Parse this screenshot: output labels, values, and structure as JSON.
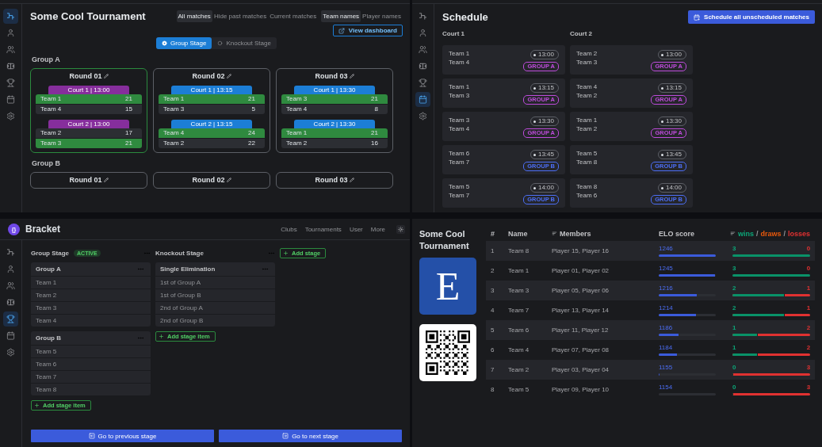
{
  "dashboard": {
    "sidebar": [
      {
        "kind": "bracket",
        "selected": true
      },
      {
        "kind": "user",
        "selected": false
      },
      {
        "kind": "users",
        "selected": false
      },
      {
        "kind": "court",
        "selected": false
      },
      {
        "kind": "trophy",
        "selected": false
      },
      {
        "kind": "calendar",
        "selected": false
      },
      {
        "kind": "settings",
        "selected": false
      }
    ],
    "title": "Some Cool Tournament",
    "filters": [
      {
        "label": "All matches",
        "selected": true
      },
      {
        "label": "Hide past matches",
        "selected": false
      },
      {
        "label": "Current matches",
        "selected": false
      }
    ],
    "name_modes": [
      {
        "label": "Team names",
        "selected": true
      },
      {
        "label": "Player names",
        "selected": false
      }
    ],
    "view_button": "View dashboard",
    "stage_tabs": [
      {
        "label": "Group Stage",
        "selected": true
      },
      {
        "label": "Knockout Stage",
        "selected": false
      }
    ],
    "groups": [
      {
        "name": "Group A",
        "rounds": [
          {
            "title": "Round 01",
            "active": true,
            "matches": [
              {
                "court": "Court 1 | 13:00",
                "color": "#862e9c",
                "teams": [
                  {
                    "name": "Team 1",
                    "score": "21",
                    "won": true
                  },
                  {
                    "name": "Team 4",
                    "score": "15",
                    "won": false
                  }
                ]
              },
              {
                "court": "Court 2 | 13:00",
                "color": "#862e9c",
                "teams": [
                  {
                    "name": "Team 2",
                    "score": "17",
                    "won": false
                  },
                  {
                    "name": "Team 3",
                    "score": "21",
                    "won": true
                  }
                ]
              }
            ]
          },
          {
            "title": "Round 02",
            "active": false,
            "matches": [
              {
                "court": "Court 1 | 13:15",
                "color": "#1c7ed6",
                "teams": [
                  {
                    "name": "Team 1",
                    "score": "21",
                    "won": true
                  },
                  {
                    "name": "Team 3",
                    "score": "5",
                    "won": false
                  }
                ]
              },
              {
                "court": "Court 2 | 13:15",
                "color": "#1c7ed6",
                "teams": [
                  {
                    "name": "Team 4",
                    "score": "24",
                    "won": true
                  },
                  {
                    "name": "Team 2",
                    "score": "22",
                    "won": false
                  }
                ]
              }
            ]
          },
          {
            "title": "Round 03",
            "active": false,
            "matches": [
              {
                "court": "Court 1 | 13:30",
                "color": "#1c7ed6",
                "teams": [
                  {
                    "name": "Team 3",
                    "score": "21",
                    "won": true
                  },
                  {
                    "name": "Team 4",
                    "score": "8",
                    "won": false
                  }
                ]
              },
              {
                "court": "Court 2 | 13:30",
                "color": "#1c7ed6",
                "teams": [
                  {
                    "name": "Team 1",
                    "score": "21",
                    "won": true
                  },
                  {
                    "name": "Team 2",
                    "score": "16",
                    "won": false
                  }
                ]
              }
            ]
          }
        ]
      },
      {
        "name": "Group B",
        "rounds": [
          {
            "title": "Round 01",
            "active": false
          },
          {
            "title": "Round 02",
            "active": false
          },
          {
            "title": "Round 03",
            "active": false
          }
        ]
      }
    ]
  },
  "schedule": {
    "sidebar": [
      {
        "kind": "bracket",
        "selected": false
      },
      {
        "kind": "user",
        "selected": false
      },
      {
        "kind": "users",
        "selected": false
      },
      {
        "kind": "court",
        "selected": false
      },
      {
        "kind": "trophy",
        "selected": false
      },
      {
        "kind": "calendar",
        "selected": true
      },
      {
        "kind": "settings",
        "selected": false
      }
    ],
    "title": "Schedule",
    "button": "Schedule all unscheduled matches",
    "courts": [
      {
        "name": "Court 1",
        "matches": [
          {
            "teams": [
              "Team 1",
              "Team 4"
            ],
            "time": "13:00",
            "group": "GROUP A",
            "color": "#be4bdb"
          },
          {
            "teams": [
              "Team 1",
              "Team 3"
            ],
            "time": "13:15",
            "group": "GROUP A",
            "color": "#be4bdb"
          },
          {
            "teams": [
              "Team 3",
              "Team 4"
            ],
            "time": "13:30",
            "group": "GROUP A",
            "color": "#be4bdb"
          },
          {
            "teams": [
              "Team 6",
              "Team 7"
            ],
            "time": "13:45",
            "group": "GROUP B",
            "color": "#4c6ef5"
          },
          {
            "teams": [
              "Team 5",
              "Team 7"
            ],
            "time": "14:00",
            "group": "GROUP B",
            "color": "#4c6ef5"
          }
        ]
      },
      {
        "name": "Court 2",
        "matches": [
          {
            "teams": [
              "Team 2",
              "Team 3"
            ],
            "time": "13:00",
            "group": "GROUP A",
            "color": "#be4bdb"
          },
          {
            "teams": [
              "Team 4",
              "Team 2"
            ],
            "time": "13:15",
            "group": "GROUP A",
            "color": "#be4bdb"
          },
          {
            "teams": [
              "Team 1",
              "Team 2"
            ],
            "time": "13:30",
            "group": "GROUP A",
            "color": "#be4bdb"
          },
          {
            "teams": [
              "Team 5",
              "Team 8"
            ],
            "time": "13:45",
            "group": "GROUP B",
            "color": "#4c6ef5"
          },
          {
            "teams": [
              "Team 8",
              "Team 6"
            ],
            "time": "14:00",
            "group": "GROUP B",
            "color": "#4c6ef5"
          }
        ]
      }
    ]
  },
  "bracket": {
    "logo": "{}",
    "app_name": "Bracket",
    "nav": [
      "Clubs",
      "Tournaments",
      "User",
      "More"
    ],
    "sidebar": [
      {
        "kind": "bracket",
        "selected": false
      },
      {
        "kind": "user",
        "selected": false
      },
      {
        "kind": "users",
        "selected": false
      },
      {
        "kind": "court",
        "selected": false
      },
      {
        "kind": "trophy",
        "selected": true
      },
      {
        "kind": "calendar",
        "selected": false
      },
      {
        "kind": "settings",
        "selected": false
      }
    ],
    "stages": [
      {
        "title": "Group Stage",
        "badge": "ACTIVE",
        "add_item": "Add stage item",
        "items": [
          {
            "title": "Group A",
            "teams": [
              "Team 1",
              "Team 2",
              "Team 3",
              "Team 4"
            ]
          },
          {
            "title": "Group B",
            "teams": [
              "Team 5",
              "Team 6",
              "Team 7",
              "Team 8"
            ]
          }
        ]
      },
      {
        "title": "Knockout Stage",
        "add_item": "Add stage item",
        "items": [
          {
            "title": "Single Elimination",
            "teams": [
              "1st of Group A",
              "1st of Group B",
              "2nd of Group A",
              "2nd of Group B"
            ]
          }
        ]
      }
    ],
    "add_stage": "Add stage",
    "prev_button": "Go to previous stage",
    "next_button": "Go to next stage"
  },
  "standings": {
    "title": "Some Cool Tournament",
    "logo": "E",
    "columns": [
      {
        "label": "#",
        "sortable": false
      },
      {
        "label": "Name",
        "sortable": false
      },
      {
        "label": "Members",
        "sortable": true
      },
      {
        "label": "ELO score",
        "sortable": false
      }
    ],
    "record_header": {
      "sortable": true,
      "separator": "/",
      "parts": [
        {
          "label": "wins",
          "color": "#0ca678"
        },
        {
          "label": "draws",
          "color": "#e8590c"
        },
        {
          "label": "losses",
          "color": "#e03131"
        }
      ]
    },
    "rows": [
      {
        "rank": "1",
        "name": "Team 8",
        "members": "Player 15, Player 16",
        "elo": {
          "score": "1246",
          "level": 1
        },
        "record": {
          "wins": "3",
          "losses": "0",
          "level": 1
        }
      },
      {
        "rank": "2",
        "name": "Team 1",
        "members": "Player 01, Player 02",
        "elo": {
          "score": "1245",
          "level": 0.99
        },
        "record": {
          "wins": "3",
          "losses": "0",
          "level": 1
        }
      },
      {
        "rank": "3",
        "name": "Team 3",
        "members": "Player 05, Player 06",
        "elo": {
          "score": "1216",
          "level": 0.67
        },
        "record": {
          "wins": "2",
          "losses": "1",
          "level": 0.67
        }
      },
      {
        "rank": "4",
        "name": "Team 7",
        "members": "Player 13, Player 14",
        "elo": {
          "score": "1214",
          "level": 0.65
        },
        "record": {
          "wins": "2",
          "losses": "1",
          "level": 0.67
        }
      },
      {
        "rank": "5",
        "name": "Team 6",
        "members": "Player 11, Player 12",
        "elo": {
          "score": "1186",
          "level": 0.35
        },
        "record": {
          "wins": "1",
          "losses": "2",
          "level": 0.33
        }
      },
      {
        "rank": "6",
        "name": "Team 4",
        "members": "Player 07, Player 08",
        "elo": {
          "score": "1184",
          "level": 0.32
        },
        "record": {
          "wins": "1",
          "losses": "2",
          "level": 0.33
        }
      },
      {
        "rank": "7",
        "name": "Team 2",
        "members": "Player 03, Player 04",
        "elo": {
          "score": "1155",
          "level": 0.01
        },
        "record": {
          "wins": "0",
          "losses": "3",
          "level": 0
        }
      },
      {
        "rank": "8",
        "name": "Team 5",
        "members": "Player 09, Player 10",
        "elo": {
          "score": "1154",
          "level": 0
        },
        "record": {
          "wins": "0",
          "losses": "3",
          "level": 0
        }
      }
    ]
  }
}
